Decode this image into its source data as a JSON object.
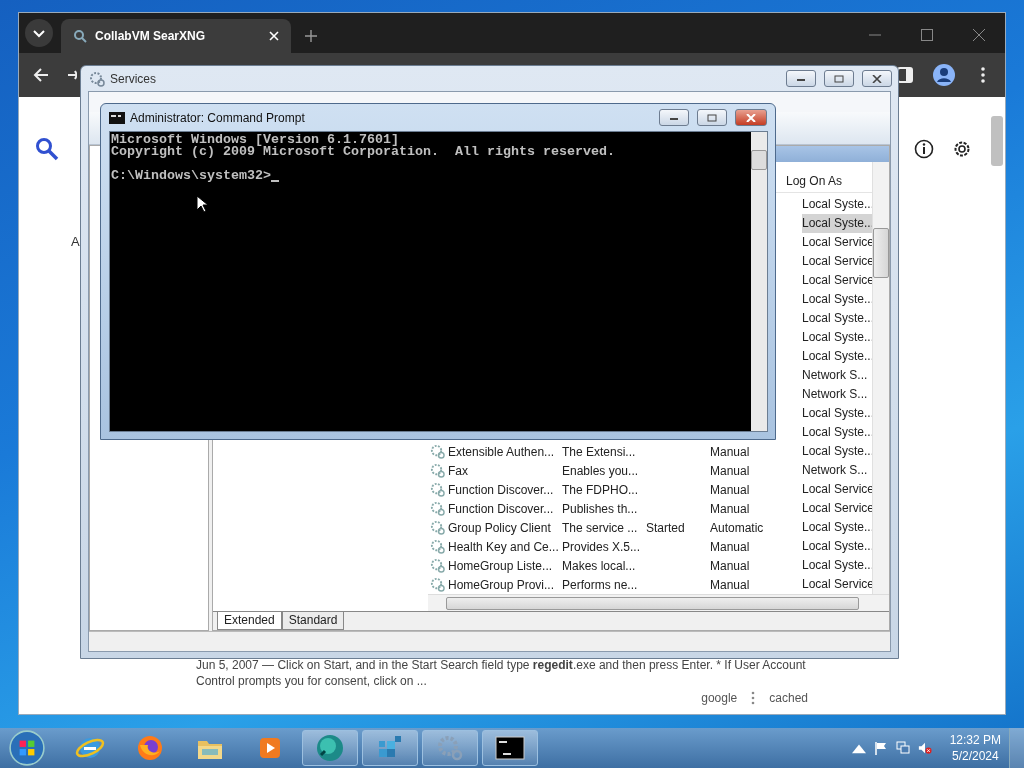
{
  "browser": {
    "tab": {
      "title": "CollabVM SearXNG",
      "selected": true
    },
    "page": {
      "cut_text": "A",
      "result": {
        "snippet": "Jun 5, 2007 — Click on Start, and in the Start Search field type **regedit**.exe and then press Enter. * If User Account Control prompts you for consent, click on ...",
        "links": [
          "google",
          "cached"
        ]
      }
    }
  },
  "services": {
    "title": "Services",
    "log_on_header": "Log On As",
    "rows": [
      {
        "log_on_as": "Local Syste...",
        "selected": false
      },
      {
        "log_on_as": "Local Syste...",
        "selected": true
      },
      {
        "log_on_as": "Local Service",
        "selected": false
      },
      {
        "log_on_as": "Local Service",
        "selected": false
      },
      {
        "log_on_as": "Local Service",
        "selected": false
      },
      {
        "log_on_as": "Local Syste...",
        "selected": false
      },
      {
        "log_on_as": "Local Syste...",
        "selected": false
      },
      {
        "log_on_as": "Local Syste...",
        "selected": false
      },
      {
        "log_on_as": "Local Syste...",
        "selected": false
      },
      {
        "log_on_as": "Network S...",
        "selected": false
      },
      {
        "log_on_as": "Network S...",
        "selected": false
      },
      {
        "log_on_as": "Local Syste...",
        "selected": false
      },
      {
        "log_on_as": "Local Syste...",
        "selected": false
      },
      {
        "column_1": "Extensible Authen...",
        "column_2": "The Extensi...",
        "column_4": "Manual",
        "log_on_as": "Local Syste...",
        "selected": false
      },
      {
        "column_1": "Fax",
        "column_2": "Enables you...",
        "column_4": "Manual",
        "log_on_as": "Network S...",
        "selected": false
      },
      {
        "column_1": "Function Discover...",
        "column_2": "The FDPHO...",
        "column_4": "Manual",
        "log_on_as": "Local Service",
        "selected": false
      },
      {
        "column_1": "Function Discover...",
        "column_2": "Publishes th...",
        "column_4": "Manual",
        "log_on_as": "Local Service",
        "selected": false
      },
      {
        "column_1": "Group Policy Client",
        "column_2": "The service ...",
        "column_3": "Started",
        "column_4": "Automatic",
        "log_on_as": "Local Syste...",
        "selected": false
      },
      {
        "column_1": "Health Key and Ce...",
        "column_2": "Provides X.5...",
        "column_4": "Manual",
        "log_on_as": "Local Syste...",
        "selected": false
      },
      {
        "column_1": "HomeGroup Liste...",
        "column_2": "Makes local...",
        "column_4": "Manual",
        "log_on_as": "Local Syste...",
        "selected": false
      },
      {
        "column_1": "HomeGroup Provi...",
        "column_2": "Performs ne...",
        "column_4": "Manual",
        "log_on_as": "Local Service",
        "selected": false
      }
    ],
    "tabs": [
      {
        "label": "Extended",
        "selected": true
      },
      {
        "label": "Standard",
        "selected": false
      }
    ]
  },
  "cmd": {
    "title": "Administrator: Command Prompt",
    "output": [
      "Microsoft Windows [Version 6.1.7601]",
      "Copyright (c) 2009 Microsoft Corporation.  All rights reserved."
    ],
    "prompt": "C:\\Windows\\system32>"
  },
  "taskbar": {
    "apps": [
      {
        "kind": "ie",
        "running": false
      },
      {
        "kind": "firefox",
        "running": false
      },
      {
        "kind": "explorer",
        "running": false
      },
      {
        "kind": "media",
        "running": false
      },
      {
        "kind": "orb",
        "running": true
      },
      {
        "kind": "registry",
        "running": true
      },
      {
        "kind": "services",
        "running": true
      },
      {
        "kind": "cmd",
        "running": true
      }
    ],
    "clock": {
      "time": "12:32 PM",
      "date": "5/2/2024"
    }
  }
}
